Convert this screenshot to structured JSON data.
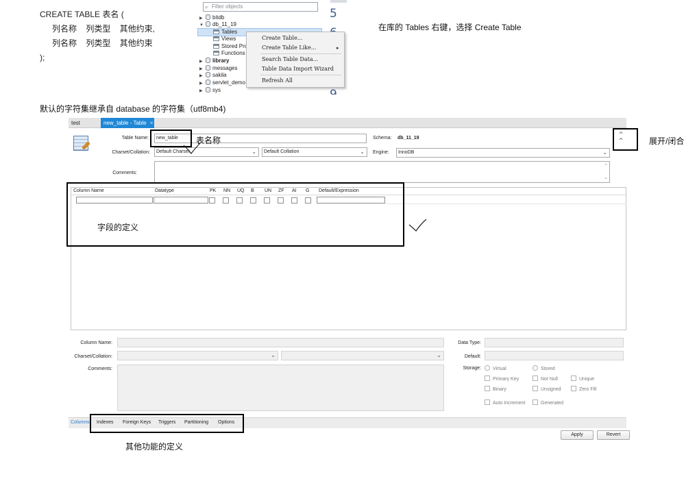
{
  "sql": {
    "line1": "CREATE TABLE 表名 (",
    "line2": "列名称    列类型    其他约束,",
    "line3": "列名称    列类型    其他约束",
    "line4": ");"
  },
  "navigator": {
    "filter_placeholder": "Filter objects",
    "items": [
      {
        "label": "bitdb"
      },
      {
        "label": "db_11_19"
      },
      {
        "label": "Tables"
      },
      {
        "label": "Views"
      },
      {
        "label": "Stored Pro"
      },
      {
        "label": "Functions"
      },
      {
        "label": "library"
      },
      {
        "label": "messages"
      },
      {
        "label": "sakila"
      },
      {
        "label": "servlet_demo"
      },
      {
        "label": "sys"
      }
    ]
  },
  "line_numbers": [
    "5",
    "6",
    "9"
  ],
  "context_menu": {
    "items": [
      "Create Table...",
      "Create Table Like...",
      "Search Table Data...",
      "Table Data Import Wizard",
      "Refresh All"
    ]
  },
  "notes": {
    "right_click": "在库的 Tables 右键，选择 Create Table",
    "charset": "默认的字符集继承自 database 的字符集（utf8mb4)",
    "table_name": "表名称",
    "expand": "展开/闭合",
    "fields": "字段的定义",
    "other": "其他功能的定义"
  },
  "editor": {
    "tabs": [
      "test",
      "new_table - Table"
    ],
    "tab_close": "×",
    "table_name_label": "Table Name:",
    "table_name_value": "new_table",
    "schema_label": "Schema:",
    "schema_value": "db_11_19",
    "charset_label": "Charset/Collation:",
    "charset_value": "Default Charset",
    "collation_value": "Default Collation",
    "engine_label": "Engine:",
    "engine_value": "InnoDB",
    "comments_label": "Comments:",
    "columns": [
      "Column Name",
      "Datatype",
      "PK",
      "NN",
      "UQ",
      "B",
      "UN",
      "ZF",
      "AI",
      "G",
      "Default/Expression"
    ],
    "detail": {
      "column_name_label": "Column Name:",
      "charset_label": "Charset/Collation:",
      "comments_label": "Comments:",
      "data_type_label": "Data Type:",
      "default_label": "Default:",
      "storage_label": "Storage:",
      "virtual": "Virtual",
      "stored": "Stored",
      "primary_key": "Primary Key",
      "not_null": "Not Null",
      "unique": "Unique",
      "binary": "Binary",
      "unsigned": "Unsigned",
      "zero_fill": "Zero Fill",
      "auto_increment": "Auto Increment",
      "generated": "Generated"
    },
    "bottom_tabs": [
      "Columns",
      "Indexes",
      "Foreign Keys",
      "Triggers",
      "Partitioning",
      "Options"
    ],
    "apply": "Apply",
    "revert": "Revert"
  },
  "colors": {
    "accent": "#1f88d6",
    "tab_active_text": "#ffffff",
    "columns_tab": "#1f78c8"
  }
}
